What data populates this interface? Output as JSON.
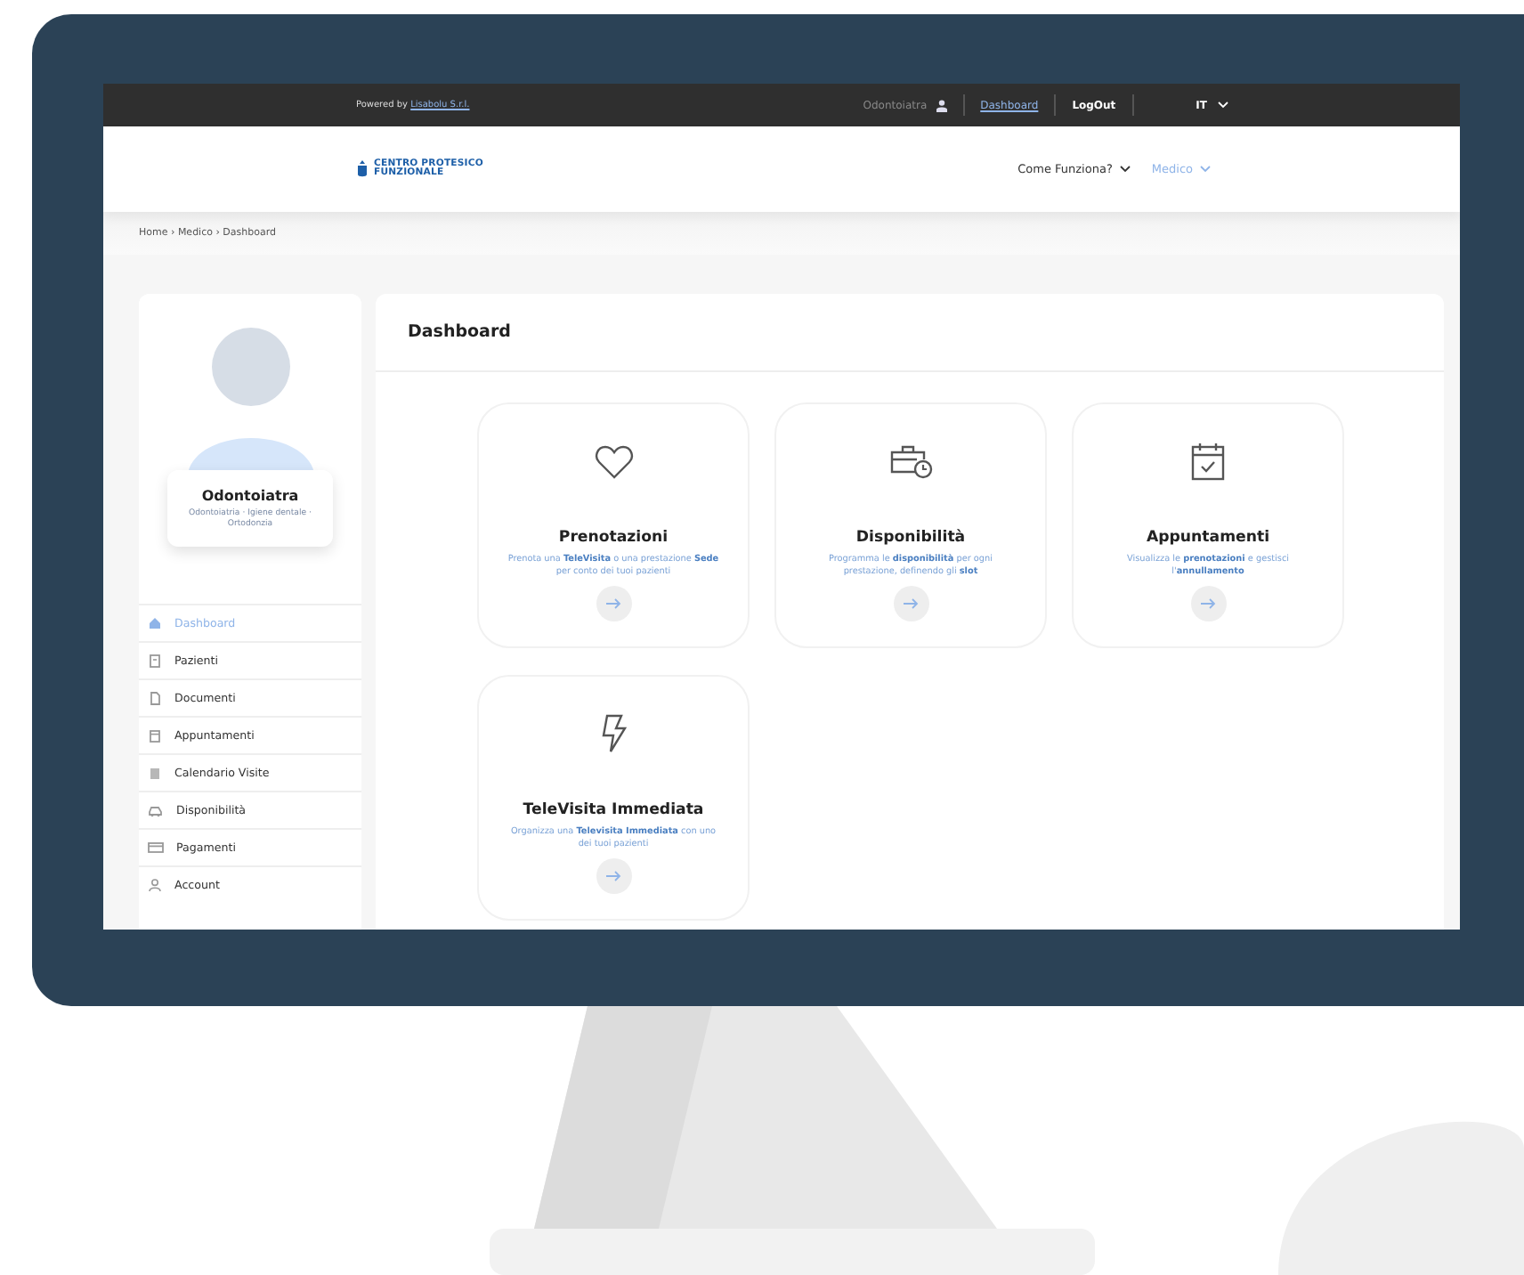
{
  "topbar": {
    "powered_by": "Powered by",
    "powered_link": "Lisabolu S.r.l.",
    "user": "Odontoiatra",
    "links": [
      {
        "label": "Dashboard",
        "selected": true
      },
      {
        "label": "LogOut",
        "selected": false
      }
    ],
    "language": "IT"
  },
  "header": {
    "logo": [
      "CENTRO PROTESICO",
      "FUNZIONALE"
    ],
    "nav": [
      {
        "label": "Come Funziona?",
        "selected": false
      },
      {
        "label": "Medico",
        "selected": true
      }
    ]
  },
  "breadcrumb": "Home › Medico › Dashboard",
  "profile": {
    "name": "Odontoiatra",
    "specialties": "Odontoiatria · Igiene dentale · Ortodonzia"
  },
  "sidebar": {
    "items": [
      {
        "label": "Dashboard",
        "selected": true
      },
      {
        "label": "Pazienti",
        "selected": false
      },
      {
        "label": "Documenti",
        "selected": false
      },
      {
        "label": "Appuntamenti",
        "selected": false
      },
      {
        "label": "Calendario Visite",
        "selected": false
      },
      {
        "label": "Disponibilità",
        "selected": false
      },
      {
        "label": "Pagamenti",
        "selected": false
      },
      {
        "label": "Account",
        "selected": false
      }
    ]
  },
  "dashboard": {
    "title": "Dashboard",
    "cards": [
      {
        "title": "Prenotazioni",
        "description": "Prenota una **TeleVisita** o una prestazione **Sede** per conto dei tuoi pazienti"
      },
      {
        "title": "Disponibilità",
        "description": "Programma le **disponibilità** per ogni prestazione, definendo gli **slot**"
      },
      {
        "title": "Appuntamenti",
        "description": "Visualizza le **prenotazioni** e gestisci l'**annullamento**"
      },
      {
        "title": "TeleVisita Immediata",
        "description": "Organizza una **Televisita Immediata** con uno dei tuoi pazienti"
      }
    ]
  }
}
